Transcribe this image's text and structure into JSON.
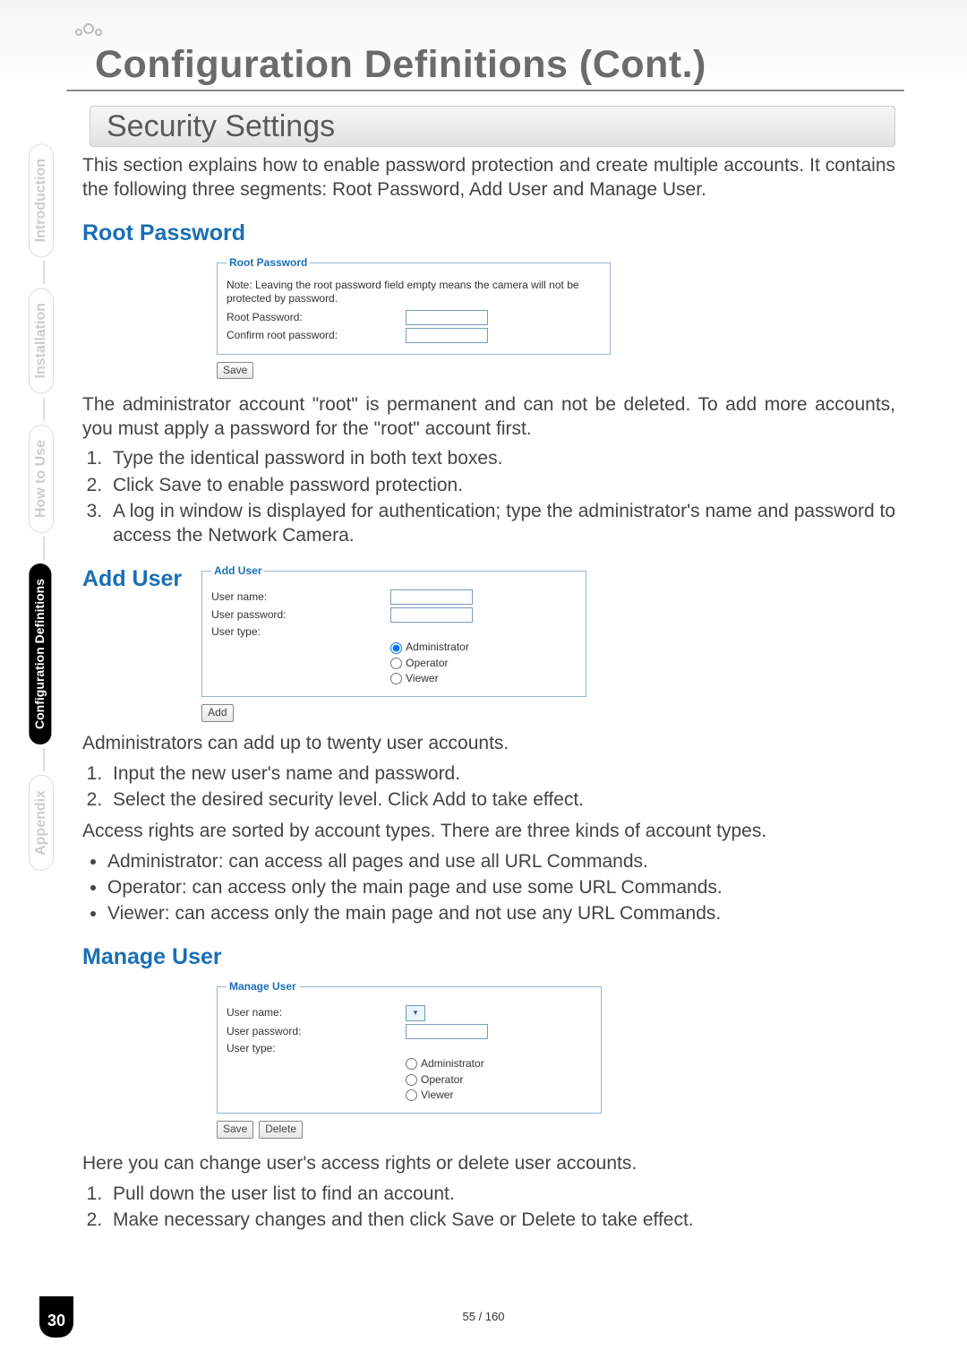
{
  "header": {
    "title": "Configuration Definitions (Cont.)",
    "section": "Security Settings"
  },
  "intro": "This section explains how to enable password protection and create multiple accounts. It contains the following three segments: Root Password, Add User and Manage User.",
  "root_password": {
    "heading": "Root Password",
    "legend": "Root Password",
    "note": "Note: Leaving the root password field empty means the camera will not be protected by password.",
    "label_pw": "Root Password:",
    "label_confirm": "Confirm root password:",
    "save": "Save",
    "desc": "The administrator account \"root\" is permanent and can not be deleted. To add more accounts, you must apply a password for the \"root\" account first.",
    "steps": [
      "Type the identical password in both text boxes.",
      "Click Save to enable password protection.",
      "A log in window is displayed for authentication; type the administrator's name and password to access the Network Camera."
    ]
  },
  "add_user": {
    "heading": "Add User",
    "legend": "Add User",
    "label_name": "User name:",
    "label_pw": "User password:",
    "label_type": "User type:",
    "radios": [
      "Administrator",
      "Operator",
      "Viewer"
    ],
    "add": "Add",
    "desc": "Administrators can add up to twenty user accounts.",
    "steps": [
      "Input the new user's name and password.",
      "Select the desired security level. Click Add to take effect."
    ],
    "rights_intro": "Access rights are sorted by account types. There are three kinds of account types.",
    "bullets": [
      "Administrator: can access all pages and use all URL Commands.",
      "Operator: can access only the main page and use some URL Commands.",
      "Viewer:  can access only the main page and not use any URL Commands."
    ]
  },
  "manage_user": {
    "heading": "Manage User",
    "legend": "Manage User",
    "label_name": "User name:",
    "label_pw": "User password:",
    "label_type": "User type:",
    "radios": [
      "Administrator",
      "Operator",
      "Viewer"
    ],
    "save": "Save",
    "delete": "Delete",
    "desc": "Here you can change user's access rights or delete user accounts.",
    "steps": [
      "Pull down the user list to find an account.",
      "Make necessary changes and then click Save or Delete to take effect."
    ]
  },
  "side_tabs": [
    "Introduction",
    "Installation",
    "How to Use",
    "Configuration Definitions",
    "Appendix"
  ],
  "footer": {
    "page_small": "55 / 160",
    "badge": "30"
  }
}
